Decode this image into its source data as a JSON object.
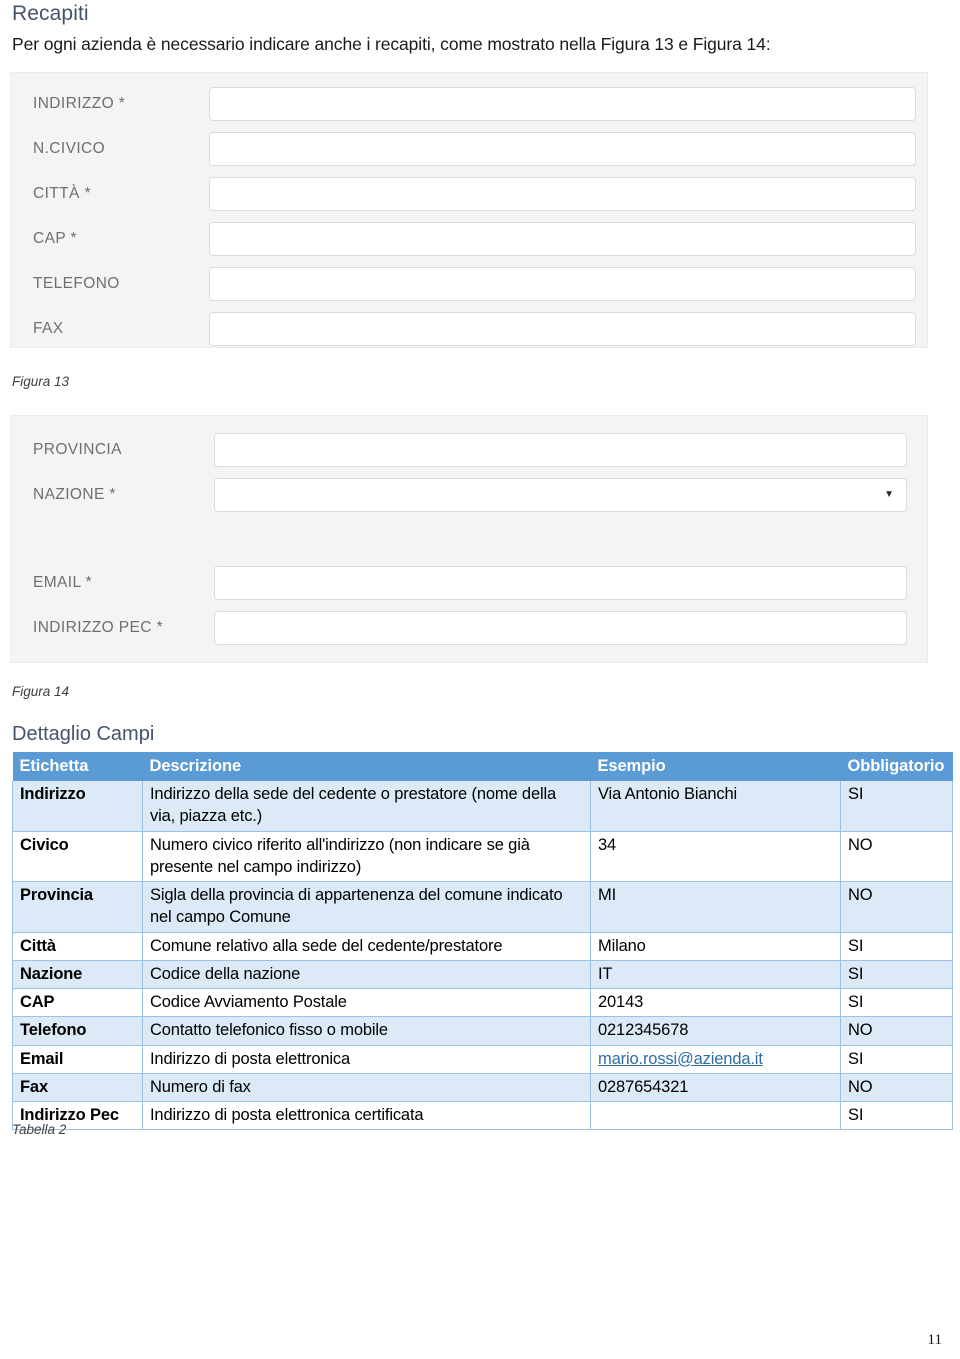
{
  "document": {
    "section_title": "Recapiti",
    "intro_paragraph": "Per ogni azienda è necessario indicare anche i recapiti, come mostrato nella Figura 13 e Figura 14:",
    "subsection_title": "Dettaglio Campi",
    "page_number": "11"
  },
  "figure13": {
    "caption": "Figura 13",
    "fields": [
      {
        "label": "INDIRIZZO *",
        "type": "text"
      },
      {
        "label": "N.CIVICO",
        "type": "text"
      },
      {
        "label": "CITTÀ *",
        "type": "text"
      },
      {
        "label": "CAP *",
        "type": "text"
      },
      {
        "label": "TELEFONO",
        "type": "text"
      },
      {
        "label": "FAX",
        "type": "text"
      }
    ]
  },
  "figure14": {
    "caption": "Figura 14",
    "fields": [
      {
        "label": "PROVINCIA",
        "type": "text"
      },
      {
        "label": "NAZIONE *",
        "type": "select",
        "caret": "▼"
      },
      {
        "label": "EMAIL *",
        "type": "text"
      },
      {
        "label": "INDIRIZZO PEC *",
        "type": "text"
      }
    ]
  },
  "table": {
    "caption": "Tabella 2",
    "headers": [
      "Etichetta",
      "Descrizione",
      "Esempio",
      "Obbligatorio"
    ],
    "rows": [
      {
        "label": "Indirizzo",
        "descrizione": "Indirizzo della sede del cedente o prestatore (nome della via, piazza etc.)",
        "esempio": "Via Antonio Bianchi",
        "obbligatorio": "SI",
        "shade": true,
        "link": false
      },
      {
        "label": "Civico",
        "descrizione": "Numero civico riferito all'indirizzo (non indicare se già presente nel campo indirizzo)",
        "esempio": "34",
        "obbligatorio": "NO",
        "shade": false,
        "link": false
      },
      {
        "label": "Provincia",
        "descrizione": "Sigla della provincia di appartenenza del comune indicato nel campo Comune",
        "esempio": "MI",
        "obbligatorio": "NO",
        "shade": true,
        "link": false
      },
      {
        "label": "Città",
        "descrizione": "Comune relativo alla sede del cedente/prestatore",
        "esempio": "Milano",
        "obbligatorio": "SI",
        "shade": false,
        "link": false
      },
      {
        "label": "Nazione",
        "descrizione": "Codice della nazione",
        "esempio": "IT",
        "obbligatorio": "SI",
        "shade": true,
        "link": false
      },
      {
        "label": "CAP",
        "descrizione": "Codice Avviamento Postale",
        "esempio": "20143",
        "obbligatorio": "SI",
        "shade": false,
        "link": false
      },
      {
        "label": "Telefono",
        "descrizione": "Contatto telefonico fisso o mobile",
        "esempio": "0212345678",
        "obbligatorio": "NO",
        "shade": true,
        "link": false
      },
      {
        "label": "Email",
        "descrizione": "Indirizzo di posta elettronica",
        "esempio": "mario.rossi@azienda.it",
        "obbligatorio": "SI",
        "shade": false,
        "link": true
      },
      {
        "label": "Fax",
        "descrizione": "Numero di fax",
        "esempio": "0287654321",
        "obbligatorio": "NO",
        "shade": true,
        "link": false
      },
      {
        "label": "Indirizzo Pec",
        "descrizione": "Indirizzo di posta elettronica certificata",
        "esempio": "",
        "obbligatorio": "SI",
        "shade": false,
        "link": false
      }
    ]
  },
  "colors": {
    "heading": "#44546a",
    "table_header_bg": "#5b9bd5",
    "table_shade_bg": "#dce9f7",
    "table_border": "#9cc3e5",
    "link": "#2e6da4",
    "figure_bg": "#f4f4f4"
  }
}
